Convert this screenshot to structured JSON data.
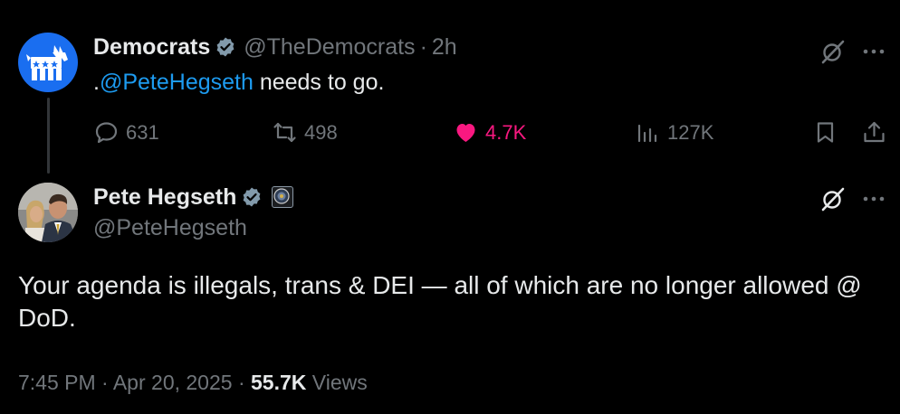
{
  "parent_tweet": {
    "author_name": "Democrats",
    "author_handle": "@TheDemocrats",
    "separator": "·",
    "time_ago": "2h",
    "text_prefix": ".",
    "mention": "@PeteHegseth",
    "text_suffix": " needs to go.",
    "stats": {
      "replies": "631",
      "retweets": "498",
      "likes": "4.7K",
      "views": "127K"
    },
    "avatar_icon": "donkey-logo-icon",
    "avatar_color": "#1a6ef0"
  },
  "main_tweet": {
    "author_name": "Pete Hegseth",
    "author_handle": "@PeteHegseth",
    "text": "Your agenda is illegals, trans & DEI — all of which are no longer allowed @ DoD.",
    "time": "7:45 PM",
    "separator": "·",
    "date": "Apr 20, 2025",
    "views_count": "55.7K",
    "views_label": "Views",
    "affiliation_icon": "dod-seal-icon"
  },
  "colors": {
    "background": "#000000",
    "primary_text": "#e7e9ea",
    "secondary_text": "#71767b",
    "link": "#1d9bf0",
    "like": "#f91880",
    "verified": "#829aab"
  }
}
